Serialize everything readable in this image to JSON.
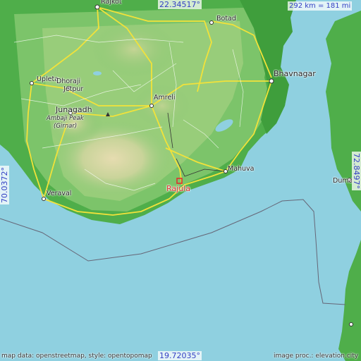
{
  "map": {
    "highlight_city": "Rajula",
    "colors": {
      "sea": "#8fd0e0",
      "lowland": "#4fae4a",
      "highland": "#d9d4a0",
      "road": "#f2e23a",
      "coast_marker": "#e03030",
      "coords": "#3340c4"
    }
  },
  "cities": [
    {
      "key": "rajkot",
      "name": "Rajkot"
    },
    {
      "key": "botad",
      "name": "Botad"
    },
    {
      "key": "upleta",
      "name": "Upleta"
    },
    {
      "key": "dhoraji",
      "name": "Dhoraji"
    },
    {
      "key": "jetpur",
      "name": "Jetpur"
    },
    {
      "key": "bhavnagar",
      "name": "Bhavnagar"
    },
    {
      "key": "amreli",
      "name": "Amreli"
    },
    {
      "key": "junagadh",
      "name": "Junagadh"
    },
    {
      "key": "ambaji",
      "name": "Ambaji Peak"
    },
    {
      "key": "girnar",
      "name": "(Girnar)"
    },
    {
      "key": "mahuva",
      "name": "Mahuva"
    },
    {
      "key": "veraval",
      "name": "Veraval"
    },
    {
      "key": "rajula",
      "name": "Rajula"
    },
    {
      "key": "duma",
      "name": "Duma"
    }
  ],
  "coords": {
    "top": "22.34517°",
    "bottom": "19.72035°",
    "left": "70.0372°",
    "right": "72.8497°",
    "scale": "292 km = 181 mi"
  },
  "footer": {
    "left": "map data: openstreetmap, style: opentopomap",
    "right": "image proc.: elevation.city"
  }
}
